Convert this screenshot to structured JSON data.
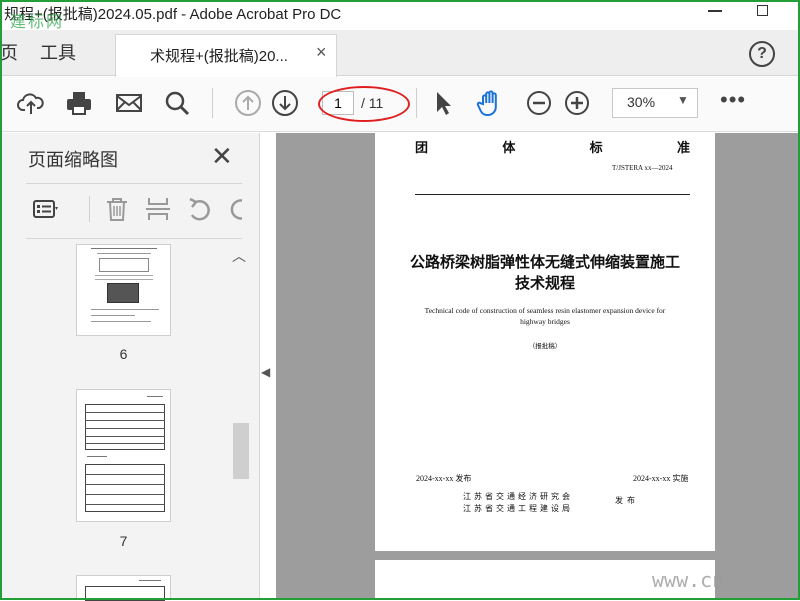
{
  "window": {
    "title": "规程+(报批稿)2024.05.pdf - Adobe Acrobat Pro DC",
    "watermark_top": "建标网"
  },
  "tabs": {
    "home_partial": "页",
    "tools": "工具",
    "document": "术规程+(报批稿)20...",
    "close_glyph": "×"
  },
  "toolbar": {
    "icons": [
      "upload-cloud-icon",
      "print-icon",
      "email-icon",
      "search-icon",
      "page-up-icon",
      "page-down-icon",
      "select-arrow-icon",
      "hand-icon",
      "zoom-out-icon",
      "zoom-in-icon"
    ],
    "page_current": "1",
    "page_total": "/ 11",
    "zoom": "30%",
    "more": "•••"
  },
  "thumbnail_panel": {
    "title": "页面缩略图",
    "close_glyph": "✕",
    "pages": [
      {
        "number": "6"
      },
      {
        "number": "7"
      }
    ]
  },
  "document": {
    "header_chars": [
      "团",
      "体",
      "标",
      "准"
    ],
    "code": "T/JSTERA xx—2024",
    "main_title": "公路桥梁树脂弹性体无缝式伸缩装置施工技术规程",
    "english_title": "Technical code of construction of seamless resin elastomer expansion device for highway bridges",
    "draft_tag": "（报批稿）",
    "release_date": "2024-xx-xx 发布",
    "implement_date": "2024-xx-xx 实施",
    "issuer_line1": "江苏省交通经济研究会",
    "issuer_line2": "江苏省交通工程建设局",
    "publish_word": "发布"
  },
  "watermark_bottom": "www.cn",
  "colors": {
    "frame": "#22a037",
    "annotation_circle": "#e02020",
    "doc_background": "#9d9d9d"
  }
}
